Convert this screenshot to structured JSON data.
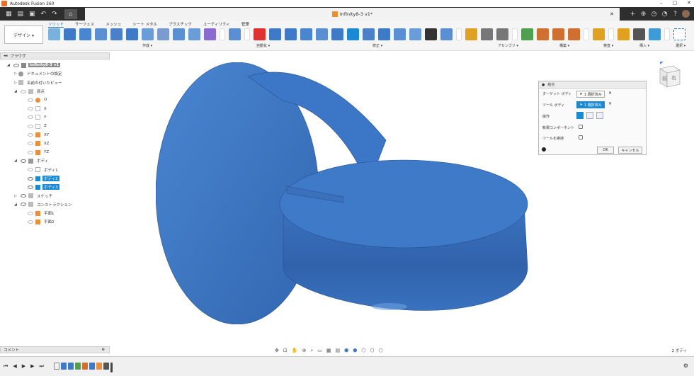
{
  "app": {
    "title": "Autodesk Fusion 360",
    "document_tab": "Infinity8-3 v1*"
  },
  "window_controls": {
    "minimize": "–",
    "maximize": "□",
    "close": "✕"
  },
  "toolbar": {
    "workspace": "デザイン ▾",
    "tabs": [
      "ソリッド",
      "サーフェス",
      "メッシュ",
      "シート メタル",
      "プラスチック",
      "ユーティリティ",
      "管理"
    ],
    "groups": [
      {
        "label": "作成 ▾"
      },
      {
        "label": "自動化 ▾"
      },
      {
        "label": "修正 ▾"
      },
      {
        "label": "アセンブリ ▾"
      },
      {
        "label": "構築 ▾"
      },
      {
        "label": "検査 ▾"
      },
      {
        "label": "挿入 ▾"
      },
      {
        "label": "選択 ▾"
      }
    ]
  },
  "browser": {
    "header": "ブラウザ",
    "items": [
      {
        "label": "Infinity8-3 v1"
      },
      {
        "label": "ドキュメントの設定"
      },
      {
        "label": "名前の付いたビュー"
      },
      {
        "label": "原点"
      },
      {
        "label": "O"
      },
      {
        "label": "X"
      },
      {
        "label": "Y"
      },
      {
        "label": "Z"
      },
      {
        "label": "XY"
      },
      {
        "label": "XZ"
      },
      {
        "label": "YZ"
      },
      {
        "label": "ボディ"
      },
      {
        "label": "ボディ1"
      },
      {
        "label": "ボディ2"
      },
      {
        "label": "ボディ3"
      },
      {
        "label": "スケッチ"
      },
      {
        "label": "コンストラクション"
      },
      {
        "label": "平面1"
      },
      {
        "label": "平面2"
      }
    ]
  },
  "dialog": {
    "title": "結合",
    "target_label": "ターゲット ボディ",
    "target_value": "1 選択済み",
    "tool_label": "ツール ボディ",
    "tool_value": "1 選択済み",
    "operation_label": "操作",
    "new_component_label": "新規コンポーネント",
    "keep_tools_label": "ツールを維持",
    "ok": "OK",
    "cancel": "キャンセル"
  },
  "comments": {
    "label": "コメント"
  },
  "status": {
    "body_count": "2 ボディ"
  },
  "colors": {
    "model": "#3f7ac8",
    "selection": "#1a8ad4",
    "accent": "#1a73c8"
  }
}
